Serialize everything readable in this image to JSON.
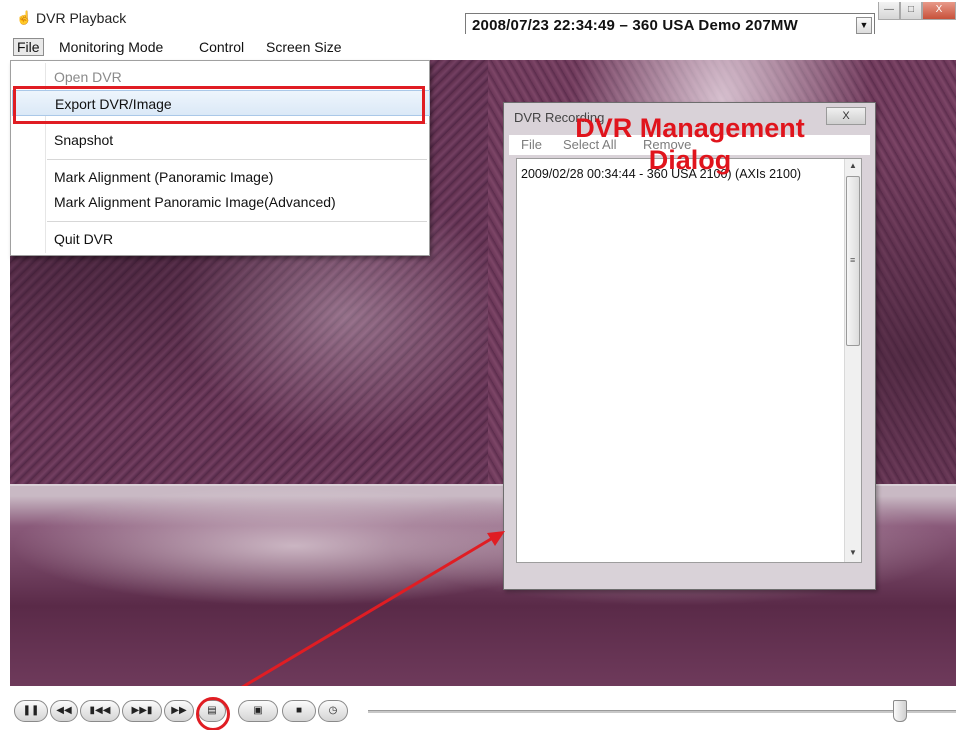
{
  "window": {
    "title": "DVR Playback",
    "app_icon": "hand-icon",
    "recording_selector": "2008/07/23 22:34:49  – 360 USA Demo 207MW",
    "close_glyph": "X"
  },
  "menubar": {
    "items": [
      "File",
      "Monitoring Mode",
      "Control",
      "Screen Size"
    ]
  },
  "file_menu": {
    "items": [
      {
        "label": "Open DVR",
        "disabled": true
      },
      {
        "label": "Export DVR/Image",
        "highlighted": true
      },
      {
        "label": "Snapshot"
      },
      {
        "label": "Mark Alignment (Panoramic Image)"
      },
      {
        "label": "Mark Alignment Panoramic Image(Advanced)"
      },
      {
        "label": "Quit DVR"
      }
    ]
  },
  "dialog": {
    "title": "DVR Recording",
    "menu": [
      "File",
      "Select All",
      "Remove"
    ],
    "rows": [
      "2009/02/28 00:34:44 - 360 USA 2100) (AXIs 2100)"
    ],
    "close_glyph": "X"
  },
  "annotation": {
    "line1": "DVR Management",
    "line2": "Dialog",
    "color": "#e0141c"
  },
  "controls": {
    "buttons": [
      "pause-icon",
      "rewind-icon",
      "previous-icon",
      "next-icon",
      "fast-forward-icon",
      "dvr-manage-icon",
      "camera-icon",
      "stop-icon",
      "clock-icon"
    ]
  },
  "colors": {
    "highlight_red": "#e01d23",
    "menu_hover": "#dbe9f7"
  }
}
